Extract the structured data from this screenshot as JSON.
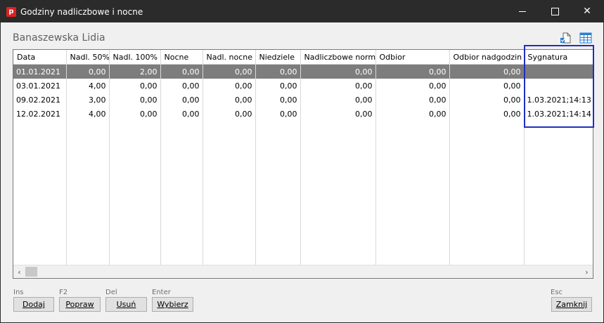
{
  "window": {
    "title": "Godziny nadliczbowe i nocne",
    "app_icon_letter": "p",
    "controls": {
      "minimize": "minimize",
      "maximize": "maximize",
      "close": "✕"
    }
  },
  "employee_name": "Banaszewska Lidia",
  "toolbar_icons": [
    "export-icon",
    "table-icon"
  ],
  "table": {
    "columns": [
      "Data",
      "Nadl. 50%",
      "Nadl. 100%",
      "Nocne",
      "Nadl. nocne",
      "Niedziele",
      "Nadliczbowe norma",
      "Odbior",
      "Odbior nadgodzin",
      "Sygnatura"
    ],
    "rows": [
      [
        "01.01.2021",
        "0,00",
        "2,00",
        "0,00",
        "0,00",
        "0,00",
        "0,00",
        "0,00",
        "0,00",
        ""
      ],
      [
        "03.01.2021",
        "4,00",
        "0,00",
        "0,00",
        "0,00",
        "0,00",
        "0,00",
        "0,00",
        "0,00",
        ""
      ],
      [
        "09.02.2021",
        "3,00",
        "0,00",
        "0,00",
        "0,00",
        "0,00",
        "0,00",
        "0,00",
        "0,00",
        "1.03.2021;14:13"
      ],
      [
        "12.02.2021",
        "4,00",
        "0,00",
        "0,00",
        "0,00",
        "0,00",
        "0,00",
        "0,00",
        "0,00",
        "1.03.2021;14:14"
      ]
    ],
    "selected_row": 0
  },
  "scrollbar": {
    "left_arrow": "‹",
    "right_arrow": "›"
  },
  "buttons": {
    "add": {
      "shortcut": "Ins",
      "label": "Dodaj"
    },
    "edit": {
      "shortcut": "F2",
      "label": "Popraw"
    },
    "delete": {
      "shortcut": "Del",
      "label": "Usuń"
    },
    "choose": {
      "shortcut": "Enter",
      "label": "Wybierz"
    },
    "close": {
      "shortcut": "Esc",
      "label": "Zamknij"
    }
  },
  "colors": {
    "titlebar": "#2b2b2b",
    "selected_row": "#7d7d7d",
    "highlight_border": "#1f2fbf",
    "app_icon": "#e02020"
  }
}
